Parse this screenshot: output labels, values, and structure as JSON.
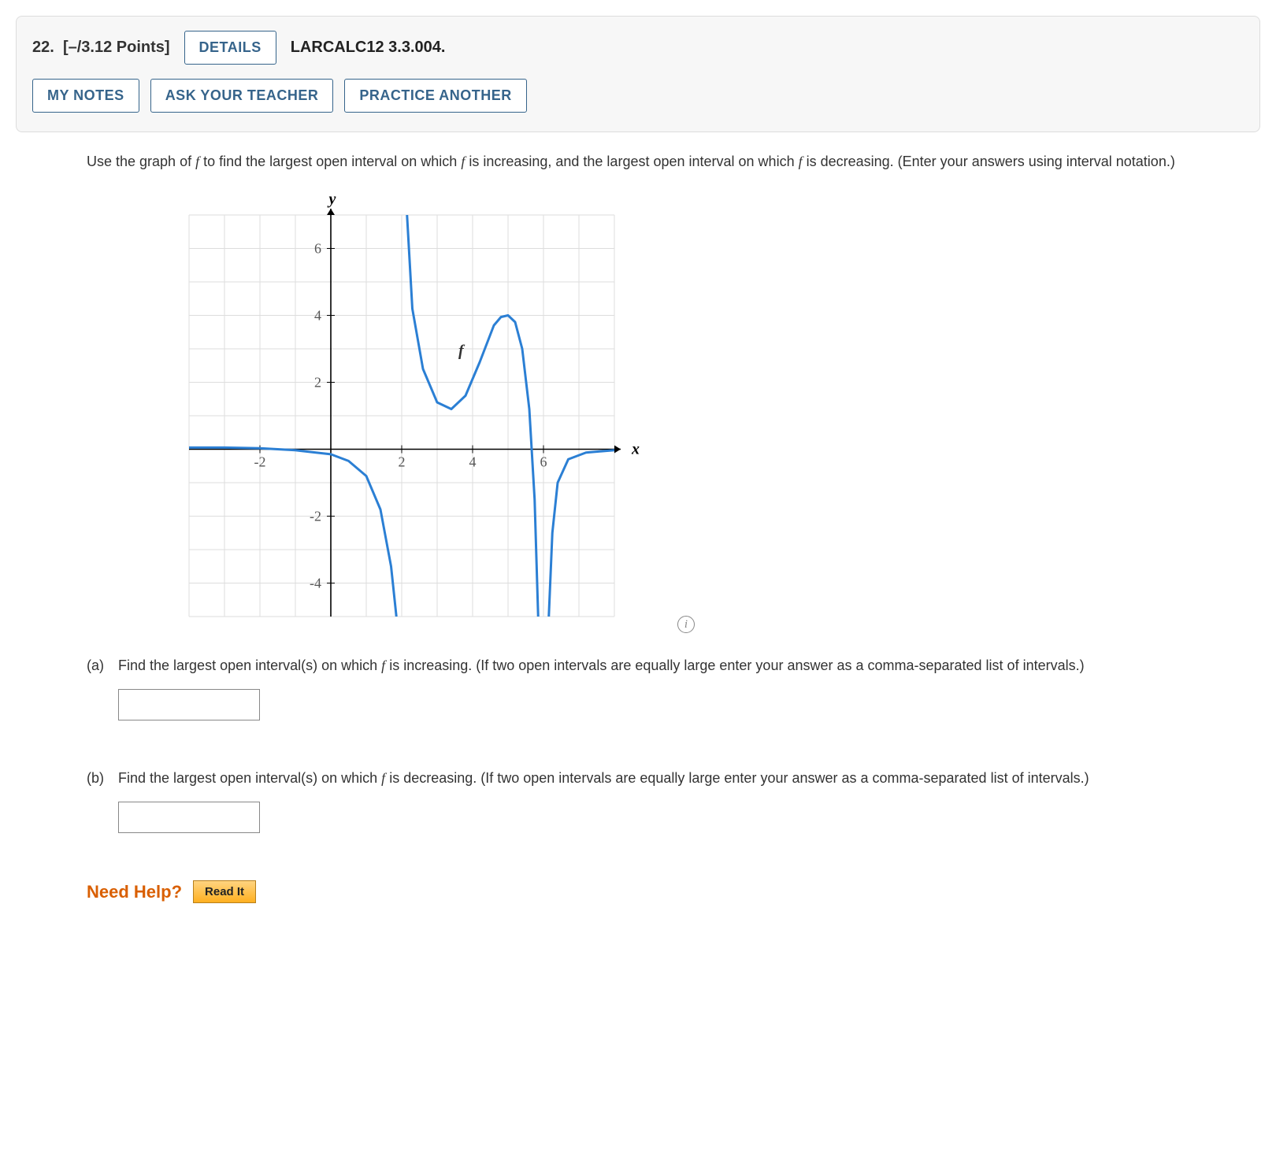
{
  "header": {
    "qnum": "22.",
    "points": "[–/3.12 Points]",
    "details_label": "DETAILS",
    "source_label": "LARCALC12 3.3.004.",
    "my_notes_label": "MY NOTES",
    "ask_teacher_label": "ASK YOUR TEACHER",
    "practice_label": "PRACTICE ANOTHER"
  },
  "prompt": {
    "line": "Use the graph of f to find the largest open interval on which f is increasing, and the largest open interval on which f is decreasing. (Enter your answers using interval notation.)"
  },
  "graph": {
    "y_label": "y",
    "x_label": "x",
    "f_label": "f",
    "y_ticks": [
      "6",
      "4",
      "2",
      "-2",
      "-4"
    ],
    "x_ticks": [
      "-2",
      "2",
      "4",
      "6"
    ]
  },
  "parts": {
    "a_label": "(a)",
    "a_text": "Find the largest open interval(s) on which f is increasing. (If two open intervals are equally large enter your answer as a comma-separated list of intervals.)",
    "b_label": "(b)",
    "b_text": "Find the largest open interval(s) on which f is decreasing. (If two open intervals are equally large enter your answer as a comma-separated list of intervals.)"
  },
  "help": {
    "need_help_label": "Need Help?",
    "read_it_label": "Read It"
  },
  "info_icon_glyph": "i",
  "chart_data": {
    "type": "line",
    "title": "",
    "xlabel": "x",
    "ylabel": "y",
    "xlim": [
      -4,
      8
    ],
    "ylim": [
      -5,
      7
    ],
    "grid": true,
    "annotations": [
      {
        "text": "f",
        "x": 3.6,
        "y": 2.8
      }
    ],
    "branches": [
      {
        "description": "left branch, asymptote at x≈2, decreasing",
        "points": [
          {
            "x": -4.0,
            "y": 0.05
          },
          {
            "x": -3.0,
            "y": 0.05
          },
          {
            "x": -2.0,
            "y": 0.03
          },
          {
            "x": -1.0,
            "y": -0.03
          },
          {
            "x": 0.0,
            "y": -0.15
          },
          {
            "x": 0.5,
            "y": -0.35
          },
          {
            "x": 1.0,
            "y": -0.8
          },
          {
            "x": 1.4,
            "y": -1.8
          },
          {
            "x": 1.7,
            "y": -3.5
          },
          {
            "x": 1.85,
            "y": -5.0
          }
        ]
      },
      {
        "description": "middle branch between x≈2 and x≈6",
        "points": [
          {
            "x": 2.15,
            "y": 7.0
          },
          {
            "x": 2.3,
            "y": 4.2
          },
          {
            "x": 2.6,
            "y": 2.4
          },
          {
            "x": 3.0,
            "y": 1.4
          },
          {
            "x": 3.4,
            "y": 1.2
          },
          {
            "x": 3.8,
            "y": 1.6
          },
          {
            "x": 4.2,
            "y": 2.6
          },
          {
            "x": 4.6,
            "y": 3.7
          },
          {
            "x": 4.8,
            "y": 3.95
          },
          {
            "x": 5.0,
            "y": 4.0
          },
          {
            "x": 5.2,
            "y": 3.8
          },
          {
            "x": 5.4,
            "y": 3.0
          },
          {
            "x": 5.6,
            "y": 1.2
          },
          {
            "x": 5.75,
            "y": -1.5
          },
          {
            "x": 5.85,
            "y": -5.0
          }
        ]
      },
      {
        "description": "right branch, asymptote at x≈6, increasing",
        "points": [
          {
            "x": 6.15,
            "y": -5.0
          },
          {
            "x": 6.25,
            "y": -2.5
          },
          {
            "x": 6.4,
            "y": -1.0
          },
          {
            "x": 6.7,
            "y": -0.3
          },
          {
            "x": 7.2,
            "y": -0.1
          },
          {
            "x": 8.0,
            "y": -0.03
          }
        ]
      }
    ]
  }
}
